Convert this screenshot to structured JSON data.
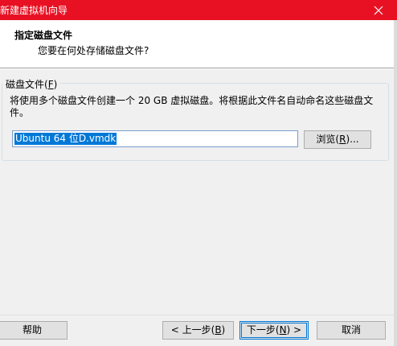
{
  "window": {
    "title": "新建虚拟机向导",
    "close_icon": "close-icon"
  },
  "header": {
    "title": "指定磁盘文件",
    "subtitle": "您要在何处存储磁盘文件?"
  },
  "disk_file_group": {
    "label_prefix": "磁盘文件(",
    "label_accel": "F",
    "label_suffix": ")",
    "description": "将使用多个磁盘文件创建一个 20 GB 虚拟磁盘。将根据此文件名自动命名这些磁盘文件。",
    "file_name_value": "Ubuntu 64 位D.vmdk",
    "browse_prefix": "浏览(",
    "browse_accel": "R",
    "browse_suffix": ")..."
  },
  "footer": {
    "help_label": "帮助",
    "back_prefix": "< 上一步(",
    "back_accel": "B",
    "back_suffix": ")",
    "next_prefix": "下一步(",
    "next_accel": "N",
    "next_suffix": ") >",
    "cancel_label": "取消"
  },
  "colors": {
    "titlebar": "#e81123",
    "selection": "#0078d7",
    "dialog_bg": "#f0f0f0"
  }
}
